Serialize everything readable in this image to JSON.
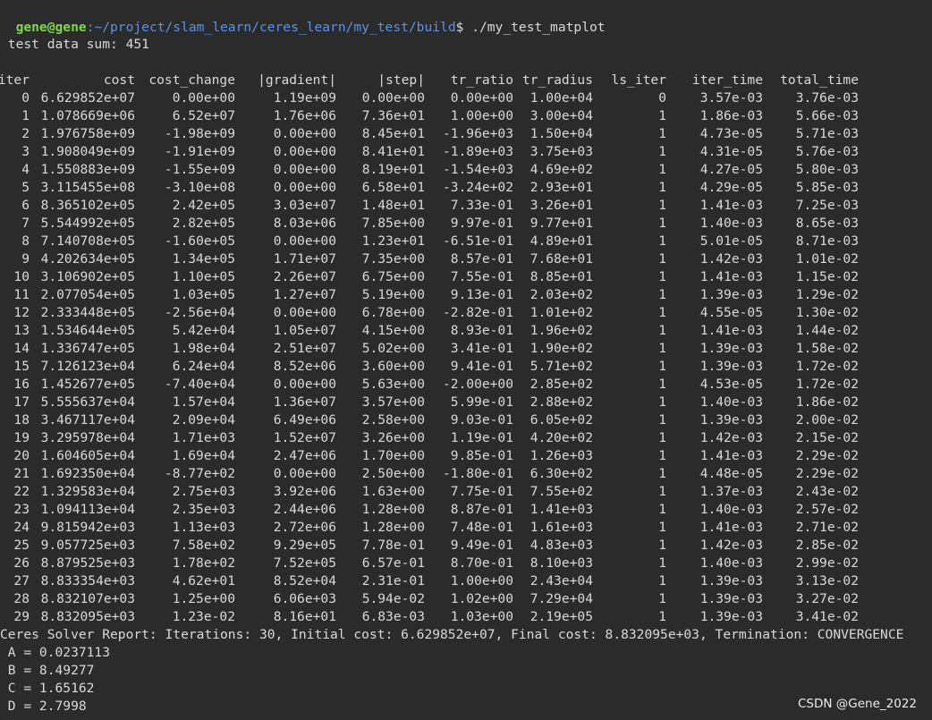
{
  "window": {
    "title": "gene@gene: ~/project/slam_learn/ceres_learn/my_test/build"
  },
  "prompt": {
    "user_host": "gene@gene",
    "path": ":~/project/slam_learn/ceres_learn/my_test/build",
    "symbol": "$",
    "command": " ./my_test_matplot"
  },
  "summary_line": " test data sum: 451",
  "table": {
    "headers": [
      "iter",
      "cost",
      "cost_change",
      "|gradient|",
      "|step|",
      "tr_ratio",
      "tr_radius",
      "ls_iter",
      "iter_time",
      "total_time"
    ],
    "rows": [
      [
        "0",
        "6.629852e+07",
        "0.00e+00",
        "1.19e+09",
        "0.00e+00",
        "0.00e+00",
        "1.00e+04",
        "0",
        "3.57e-03",
        "3.76e-03"
      ],
      [
        "1",
        "1.078669e+06",
        "6.52e+07",
        "1.76e+06",
        "7.36e+01",
        "1.00e+00",
        "3.00e+04",
        "1",
        "1.86e-03",
        "5.66e-03"
      ],
      [
        "2",
        "1.976758e+09",
        "-1.98e+09",
        "0.00e+00",
        "8.45e+01",
        "-1.96e+03",
        "1.50e+04",
        "1",
        "4.73e-05",
        "5.71e-03"
      ],
      [
        "3",
        "1.908049e+09",
        "-1.91e+09",
        "0.00e+00",
        "8.41e+01",
        "-1.89e+03",
        "3.75e+03",
        "1",
        "4.31e-05",
        "5.76e-03"
      ],
      [
        "4",
        "1.550883e+09",
        "-1.55e+09",
        "0.00e+00",
        "8.19e+01",
        "-1.54e+03",
        "4.69e+02",
        "1",
        "4.27e-05",
        "5.80e-03"
      ],
      [
        "5",
        "3.115455e+08",
        "-3.10e+08",
        "0.00e+00",
        "6.58e+01",
        "-3.24e+02",
        "2.93e+01",
        "1",
        "4.29e-05",
        "5.85e-03"
      ],
      [
        "6",
        "8.365102e+05",
        "2.42e+05",
        "3.03e+07",
        "1.48e+01",
        "7.33e-01",
        "3.26e+01",
        "1",
        "1.41e-03",
        "7.25e-03"
      ],
      [
        "7",
        "5.544992e+05",
        "2.82e+05",
        "8.03e+06",
        "7.85e+00",
        "9.97e-01",
        "9.77e+01",
        "1",
        "1.40e-03",
        "8.65e-03"
      ],
      [
        "8",
        "7.140708e+05",
        "-1.60e+05",
        "0.00e+00",
        "1.23e+01",
        "-6.51e-01",
        "4.89e+01",
        "1",
        "5.01e-05",
        "8.71e-03"
      ],
      [
        "9",
        "4.202634e+05",
        "1.34e+05",
        "1.71e+07",
        "7.35e+00",
        "8.57e-01",
        "7.68e+01",
        "1",
        "1.42e-03",
        "1.01e-02"
      ],
      [
        "10",
        "3.106902e+05",
        "1.10e+05",
        "2.26e+07",
        "6.75e+00",
        "7.55e-01",
        "8.85e+01",
        "1",
        "1.41e-03",
        "1.15e-02"
      ],
      [
        "11",
        "2.077054e+05",
        "1.03e+05",
        "1.27e+07",
        "5.19e+00",
        "9.13e-01",
        "2.03e+02",
        "1",
        "1.39e-03",
        "1.29e-02"
      ],
      [
        "12",
        "2.333448e+05",
        "-2.56e+04",
        "0.00e+00",
        "6.78e+00",
        "-2.82e-01",
        "1.01e+02",
        "1",
        "4.55e-05",
        "1.30e-02"
      ],
      [
        "13",
        "1.534644e+05",
        "5.42e+04",
        "1.05e+07",
        "4.15e+00",
        "8.93e-01",
        "1.96e+02",
        "1",
        "1.41e-03",
        "1.44e-02"
      ],
      [
        "14",
        "1.336747e+05",
        "1.98e+04",
        "2.51e+07",
        "5.02e+00",
        "3.41e-01",
        "1.90e+02",
        "1",
        "1.39e-03",
        "1.58e-02"
      ],
      [
        "15",
        "7.126123e+04",
        "6.24e+04",
        "8.52e+06",
        "3.60e+00",
        "9.41e-01",
        "5.71e+02",
        "1",
        "1.39e-03",
        "1.72e-02"
      ],
      [
        "16",
        "1.452677e+05",
        "-7.40e+04",
        "0.00e+00",
        "5.63e+00",
        "-2.00e+00",
        "2.85e+02",
        "1",
        "4.53e-05",
        "1.72e-02"
      ],
      [
        "17",
        "5.555637e+04",
        "1.57e+04",
        "1.36e+07",
        "3.57e+00",
        "5.99e-01",
        "2.88e+02",
        "1",
        "1.40e-03",
        "1.86e-02"
      ],
      [
        "18",
        "3.467117e+04",
        "2.09e+04",
        "6.49e+06",
        "2.58e+00",
        "9.03e-01",
        "6.05e+02",
        "1",
        "1.39e-03",
        "2.00e-02"
      ],
      [
        "19",
        "3.295978e+04",
        "1.71e+03",
        "1.52e+07",
        "3.26e+00",
        "1.19e-01",
        "4.20e+02",
        "1",
        "1.42e-03",
        "2.15e-02"
      ],
      [
        "20",
        "1.604605e+04",
        "1.69e+04",
        "2.47e+06",
        "1.70e+00",
        "9.85e-01",
        "1.26e+03",
        "1",
        "1.41e-03",
        "2.29e-02"
      ],
      [
        "21",
        "1.692350e+04",
        "-8.77e+02",
        "0.00e+00",
        "2.50e+00",
        "-1.80e-01",
        "6.30e+02",
        "1",
        "4.48e-05",
        "2.29e-02"
      ],
      [
        "22",
        "1.329583e+04",
        "2.75e+03",
        "3.92e+06",
        "1.63e+00",
        "7.75e-01",
        "7.55e+02",
        "1",
        "1.37e-03",
        "2.43e-02"
      ],
      [
        "23",
        "1.094113e+04",
        "2.35e+03",
        "2.44e+06",
        "1.28e+00",
        "8.87e-01",
        "1.41e+03",
        "1",
        "1.40e-03",
        "2.57e-02"
      ],
      [
        "24",
        "9.815942e+03",
        "1.13e+03",
        "2.72e+06",
        "1.28e+00",
        "7.48e-01",
        "1.61e+03",
        "1",
        "1.41e-03",
        "2.71e-02"
      ],
      [
        "25",
        "9.057725e+03",
        "7.58e+02",
        "9.29e+05",
        "7.78e-01",
        "9.49e-01",
        "4.83e+03",
        "1",
        "1.42e-03",
        "2.85e-02"
      ],
      [
        "26",
        "8.879525e+03",
        "1.78e+02",
        "7.52e+05",
        "6.57e-01",
        "8.70e-01",
        "8.10e+03",
        "1",
        "1.40e-03",
        "2.99e-02"
      ],
      [
        "27",
        "8.833354e+03",
        "4.62e+01",
        "8.52e+04",
        "2.31e-01",
        "1.00e+00",
        "2.43e+04",
        "1",
        "1.39e-03",
        "3.13e-02"
      ],
      [
        "28",
        "8.832107e+03",
        "1.25e+00",
        "6.06e+03",
        "5.94e-02",
        "1.02e+00",
        "7.29e+04",
        "1",
        "1.39e-03",
        "3.27e-02"
      ],
      [
        "29",
        "8.832095e+03",
        "1.23e-02",
        "8.16e+01",
        "6.83e-03",
        "1.03e+00",
        "2.19e+05",
        "1",
        "1.39e-03",
        "3.41e-02"
      ]
    ]
  },
  "report_line": "Ceres Solver Report: Iterations: 30, Initial cost: 6.629852e+07, Final cost: 8.832095e+03, Termination: CONVERGENCE",
  "results": [
    " A = 0.0237113",
    " B = 8.49277",
    " C = 1.65162",
    " D = 2.7998"
  ],
  "watermark": "CSDN @Gene_2022",
  "colors": {
    "background": "#2b2b2b",
    "text": "#d9d9d9",
    "prompt_user": "#7fd74c",
    "prompt_path": "#5b93e6"
  }
}
